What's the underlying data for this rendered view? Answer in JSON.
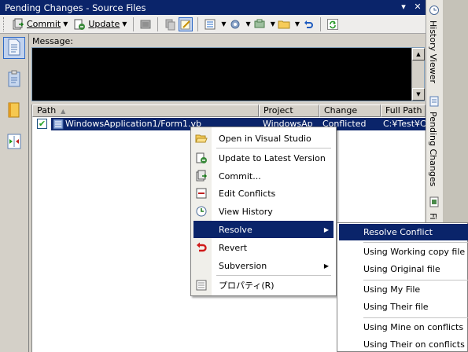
{
  "window": {
    "title": "Pending Changes - Source Files",
    "title_buttons": [
      "▾",
      "✕"
    ]
  },
  "toolbar": {
    "commit_label": "Commit",
    "update_label": "Update"
  },
  "message": {
    "label": "Message:"
  },
  "list": {
    "columns": [
      "Path",
      "Project",
      "Change",
      "Full Path"
    ],
    "rows": [
      {
        "checked": true,
        "path": "WindowsApplication1/Form1.vb",
        "project": "WindowsAp",
        "change": "Conflicted",
        "full_path": "C:¥Test¥C"
      }
    ]
  },
  "context_menu": {
    "items": [
      {
        "label": "Open in Visual Studio",
        "icon": "folder-open-icon"
      },
      {
        "label": "Update to Latest Version",
        "icon": "update-icon"
      },
      {
        "label": "Commit...",
        "icon": "commit-icon"
      },
      {
        "label": "Edit Conflicts",
        "icon": "edit-conflicts-icon"
      },
      {
        "label": "View History",
        "icon": "history-icon"
      },
      {
        "label": "Resolve",
        "icon": ""
      },
      {
        "label": "Revert",
        "icon": "revert-icon"
      },
      {
        "label": "Subversion",
        "icon": ""
      },
      {
        "label": "プロパティ(R)",
        "icon": "properties-icon"
      }
    ],
    "highlighted": "Resolve"
  },
  "resolve_submenu": {
    "items": [
      "Resolve Conflict",
      "Using Working copy file",
      "Using Original file",
      "Using My File",
      "Using Their file",
      "Using Mine on conflicts",
      "Using Their on conflicts"
    ],
    "highlighted": "Resolve Conflict"
  },
  "right_dock": {
    "tabs": [
      "History Viewer",
      "Pending Changes",
      "Fi"
    ]
  },
  "colors": {
    "titlebar": "#0a246a",
    "selection": "#0a246a",
    "panel": "#d4d0c8",
    "message_bg": "#000000"
  }
}
